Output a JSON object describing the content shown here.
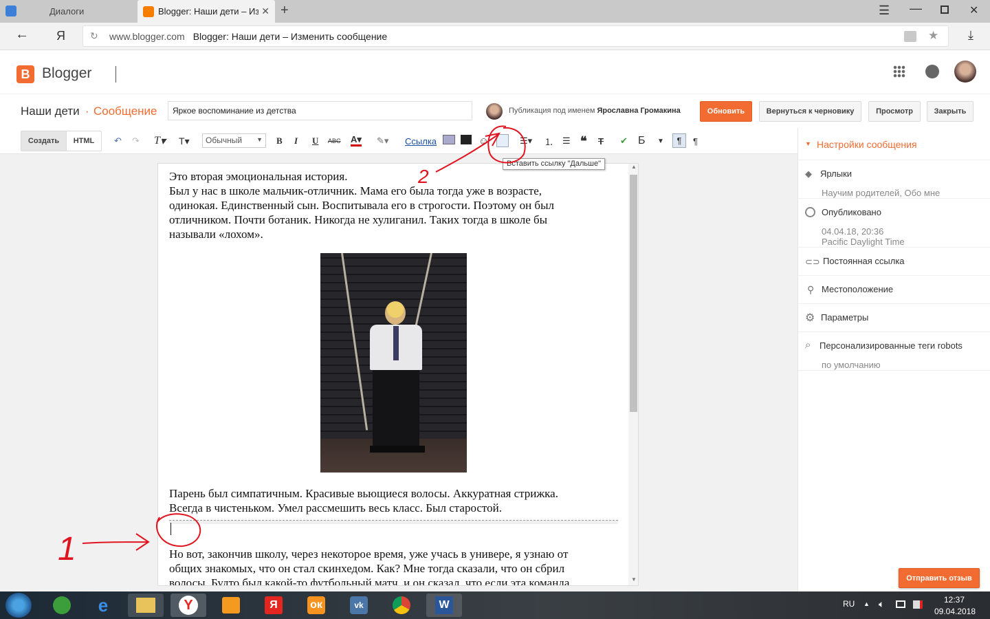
{
  "browser": {
    "tabs": [
      {
        "label": "Диалоги"
      },
      {
        "label": "Blogger: Наши дети – Из"
      }
    ],
    "url_domain": "www.blogger.com",
    "url_title": "Blogger: Наши дети – Изменить сообщение",
    "yandex_label": "Я"
  },
  "header": {
    "logo_text": "Blogger"
  },
  "post": {
    "blog_name": "Наши дети",
    "separator": "·",
    "section": "Сообщение",
    "title_value": "Яркое воспоминание из детства",
    "publish_as_prefix": "Публикация под именем",
    "author": "Ярославна Громакина",
    "buttons": {
      "update": "Обновить",
      "revert": "Вернуться к черновику",
      "preview": "Просмотр",
      "close": "Закрыть"
    }
  },
  "toolbar": {
    "compose": "Создать",
    "html": "HTML",
    "format_value": "Обычный",
    "link_label": "Ссылка",
    "bold": "B",
    "italic": "I",
    "underline": "U",
    "strike": "ABC",
    "font": "T",
    "size": "T",
    "tooltip": "Вставить ссылку \"Дальше\""
  },
  "content": {
    "p1": [
      "Это вторая эмоциональная история.",
      "Был у нас в школе мальчик-отличник. Мама его была тогда уже в возрасте,",
      "одинокая. Единственный сын. Воспитывала его в строгости. Поэтому он был",
      "отличником. Почти ботаник. Никогда не хулиганил. Таких тогда в школе бы",
      "называли «лохом»."
    ],
    "p2": [
      "Парень был симпатичным. Красивые вьющиеся волосы. Аккуратная стрижка.",
      "Всегда в чистеньком. Умел рассмешить весь класс. Был старостой."
    ],
    "p3": [
      "Но вот, закончив школу, через некоторое время, уже учась в универе, я узнаю от",
      "общих знакомых, что он стал скинхедом. Как? Мне тогда сказали, что он сбрил",
      "волосы. Будто был какой-то футбольный матч, и он сказал, что если эта команда"
    ]
  },
  "annotations": {
    "marker1": "1",
    "marker2": "2"
  },
  "sidebar": {
    "title": "Настройки сообщения",
    "labels": "Ярлыки",
    "labels_value": "Научим родителей, Обо мне",
    "published": "Опубликовано",
    "published_date": "04.04.18, 20:36",
    "published_tz": "Pacific Daylight Time",
    "permalink": "Постоянная ссылка",
    "location": "Местоположение",
    "options": "Параметры",
    "robots": "Персонализированные теги robots",
    "robots_value": "по умолчанию",
    "feedback": "Отправить отзыв"
  },
  "taskbar": {
    "lang": "RU",
    "time": "12:37",
    "date": "09.04.2018"
  },
  "colors": {
    "accent": "#f26c31",
    "blogger_orange": "#f57d00",
    "annotation_red": "#e0141e"
  }
}
